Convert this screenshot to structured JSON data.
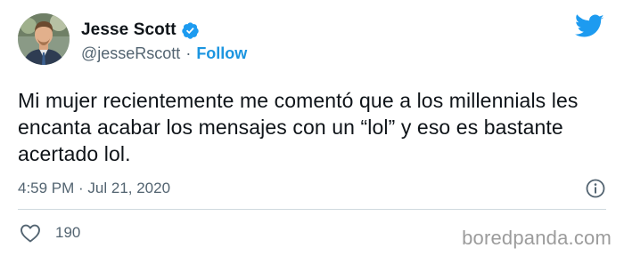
{
  "user": {
    "display_name": "Jesse Scott",
    "handle": "@jesseRscott",
    "separator": "·",
    "follow_label": "Follow"
  },
  "tweet": {
    "text": "Mi mujer recientemente me comentó que a los millennials les encanta acabar los mensajes con un “lol” y eso es bastante acertado lol.",
    "timestamp": "4:59 PM · Jul 21, 2020",
    "like_count": "190"
  },
  "watermark": "boredpanda.com",
  "icons": {
    "verified": "verified-badge-icon",
    "brand": "twitter-bird-icon",
    "info": "info-icon",
    "like": "heart-icon"
  },
  "colors": {
    "link": "#1b95e0",
    "brand": "#1d9bf0",
    "text": "#0f1419",
    "muted": "#536471"
  }
}
